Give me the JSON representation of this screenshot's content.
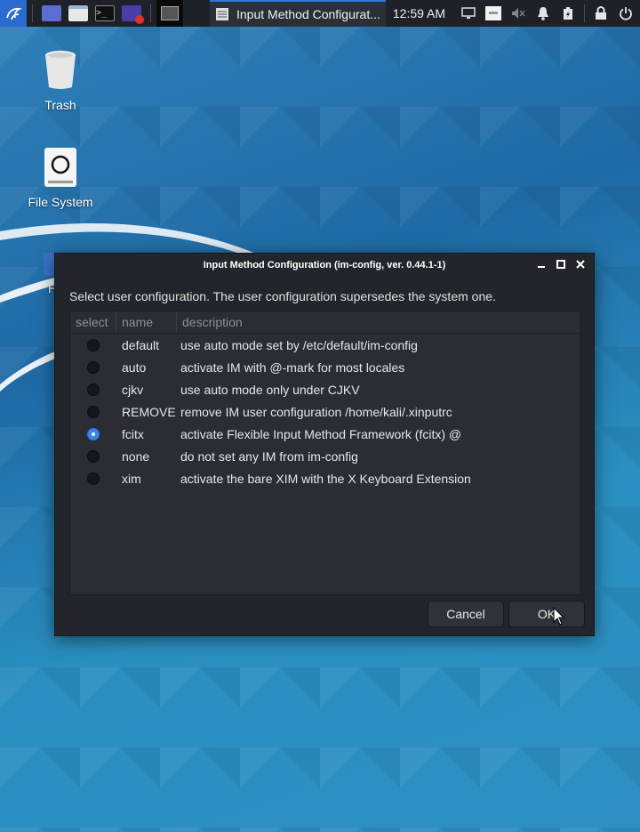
{
  "taskbar": {
    "active_window_title": "Input Method Configurat...",
    "clock": "12:59 AM"
  },
  "desktop": {
    "icons": [
      {
        "label": "Trash",
        "icon": "trash-icon"
      },
      {
        "label": "File System",
        "icon": "drive-icon"
      },
      {
        "label": "H",
        "icon": "home-folder-icon"
      }
    ]
  },
  "dialog": {
    "title": "Input Method Configuration (im-config, ver. 0.44.1-1)",
    "prompt": "Select user configuration. The user configuration supersedes the system one.",
    "columns": [
      "select",
      "name",
      "description"
    ],
    "rows": [
      {
        "selected": false,
        "name": "default",
        "description": "use auto mode set by /etc/default/im-config"
      },
      {
        "selected": false,
        "name": "auto",
        "description": "activate IM with @-mark for most locales"
      },
      {
        "selected": false,
        "name": "cjkv",
        "description": "use auto mode only under CJKV"
      },
      {
        "selected": false,
        "name": "REMOVE",
        "description": "remove IM user configuration /home/kali/.xinputrc"
      },
      {
        "selected": true,
        "name": "fcitx",
        "description": "activate Flexible Input Method Framework (fcitx) @"
      },
      {
        "selected": false,
        "name": "none",
        "description": "do not set any IM from im-config"
      },
      {
        "selected": false,
        "name": "xim",
        "description": "activate the bare XIM with the X Keyboard Extension"
      }
    ],
    "cancel_label": "Cancel",
    "ok_label": "OK"
  },
  "colors": {
    "accent": "#3a86e8",
    "dialog_bg": "#22252b",
    "panel_bg": "#1e2228"
  }
}
